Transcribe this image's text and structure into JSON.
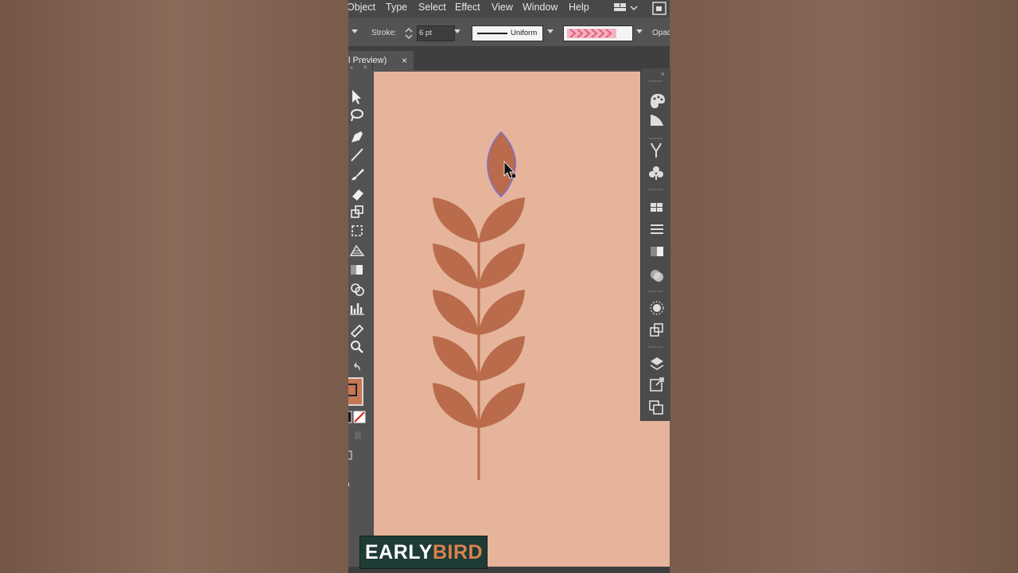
{
  "menubar": {
    "items": [
      "Object",
      "Type",
      "Select",
      "Effect",
      "View",
      "Window",
      "Help"
    ]
  },
  "controlbar": {
    "stroke_label": "Stroke:",
    "stroke_value": "6 pt",
    "profile_label": "Uniform",
    "opacity_label": "Opac"
  },
  "document_tab": {
    "label": "l Preview)",
    "close": "×"
  },
  "logo": {
    "word1": "EARLY",
    "word2": "BIRD"
  },
  "colors": {
    "artboard": "#e5b49a",
    "leaf": "#ba6b4c",
    "selection": "#7b6fd1",
    "ui_dark": "#535353"
  },
  "icons": [
    "selection-tool-icon",
    "lasso-tool-icon",
    "pen-tool-icon",
    "line-tool-icon",
    "brush-tool-icon",
    "eraser-tool-icon",
    "scale-tool-icon",
    "free-transform-icon",
    "perspective-grid-icon",
    "gradient-tool-icon",
    "shape-builder-icon",
    "graph-tool-icon",
    "eyedropper-icon",
    "zoom-icon"
  ]
}
